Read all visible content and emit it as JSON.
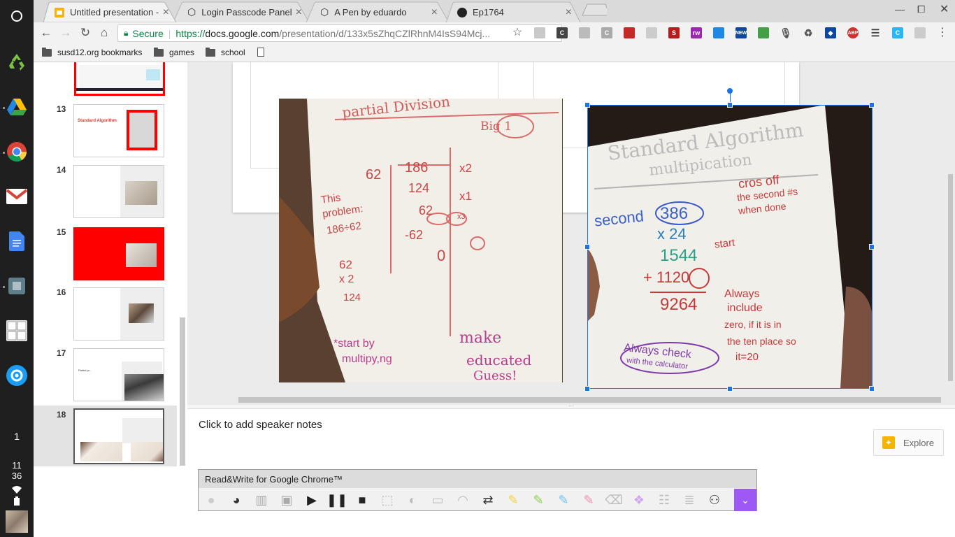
{
  "tabs": [
    {
      "title": "Untitled presentation - Go",
      "icon": "google-slides-icon",
      "active": true
    },
    {
      "title": "Login Passcode Panel",
      "icon": "codepen-icon",
      "active": false
    },
    {
      "title": "A Pen by eduardo",
      "icon": "codepen-icon",
      "active": false
    },
    {
      "title": "Ep1764",
      "icon": "github-icon",
      "active": false
    }
  ],
  "toolbar": {
    "secure_label": "Secure",
    "url_prefix": "https://",
    "url_host": "docs.google.com",
    "url_path": "/presentation/d/133x5sZhqCZlRhnM4IsS94Mcj..."
  },
  "bookmarks": {
    "items": [
      {
        "label": "susd12.org bookmarks"
      },
      {
        "label": "games"
      },
      {
        "label": "school"
      }
    ]
  },
  "slides": [
    {
      "num": "13",
      "title": "Standard Algorithm"
    },
    {
      "num": "14"
    },
    {
      "num": "15"
    },
    {
      "num": "16"
    },
    {
      "num": "17",
      "title": "Partial pr..."
    },
    {
      "num": "18"
    }
  ],
  "photo_left": {
    "header": "partial Division",
    "tag": "Big 1",
    "lines": [
      "62",
      "186",
      "124",
      "62",
      "-62",
      "0",
      "x2",
      "x1",
      "x3",
      "This",
      "problem:",
      "186÷62",
      "62",
      "x 2",
      "124",
      "*start by",
      "multipy,ng",
      "make",
      "educated",
      "Guess!"
    ]
  },
  "photo_right": {
    "title": "Standard Algorithm",
    "subtitle": "multipication",
    "lines": [
      "second",
      "386",
      "x 24",
      "1544",
      "+ 1120",
      "9264",
      "cros off",
      "the second #s",
      "when done",
      "start",
      "Always",
      "include",
      "zero, if it is in",
      "the ten place so",
      "it=20",
      "Always check",
      "with the calculator"
    ]
  },
  "notes": {
    "placeholder": "Click to add speaker notes",
    "explore_label": "Explore"
  },
  "readwrite": {
    "title": "Read&Write for Google Chrome™"
  },
  "tray": {
    "badge": "1",
    "hour": "11",
    "minute": "36"
  },
  "colors": {
    "accent": "#4285f4",
    "slides_yellow": "#f4b400",
    "red": "#ff0000",
    "purple": "#9e59f5"
  }
}
